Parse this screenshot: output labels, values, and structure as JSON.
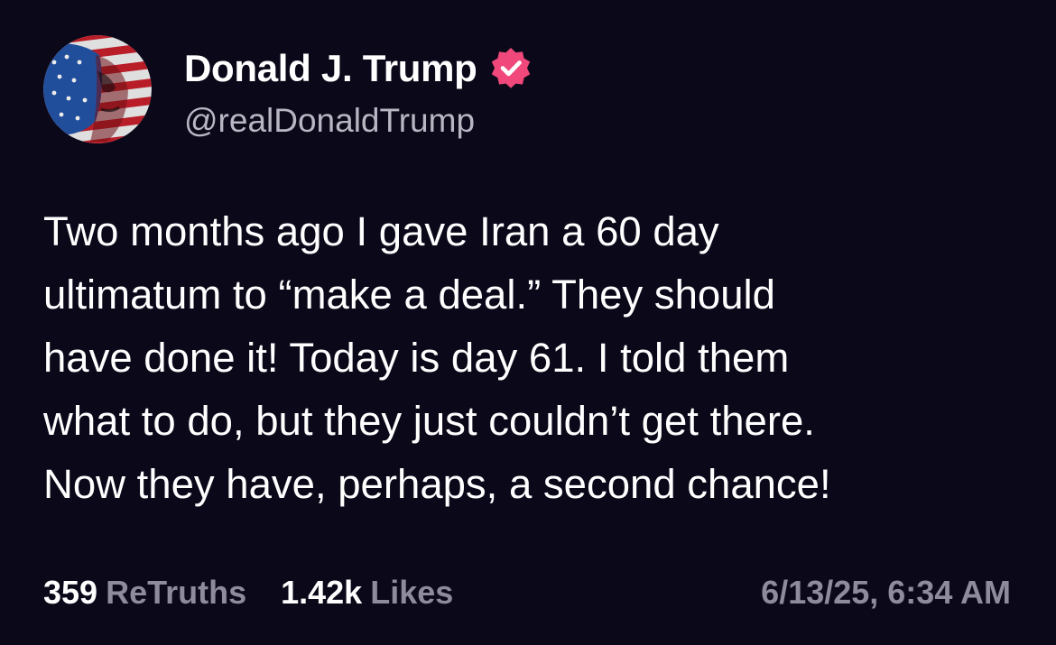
{
  "author": {
    "display_name": "Donald J. Trump",
    "handle": "@realDonaldTrump",
    "verified_icon": "verified-badge-icon",
    "verified_color": "#f0487a"
  },
  "post": {
    "text": "Two months ago I gave Iran a 60 day\nultimatum to “make a deal.” They should\nhave done it! Today is day 61. I told them\nwhat to do, but they just couldn’t get there.\nNow they have, perhaps, a second chance!"
  },
  "stats": {
    "retruths_count": "359",
    "retruths_label": "ReTruths",
    "likes_count": "1.42k",
    "likes_label": "Likes"
  },
  "timestamp": "6/13/25, 6:34 AM",
  "colors": {
    "background": "#0b0819",
    "primary_text": "#ffffff",
    "secondary_text": "#8e8b9c",
    "handle_text": "#b9b6c4",
    "accent": "#f0487a"
  }
}
